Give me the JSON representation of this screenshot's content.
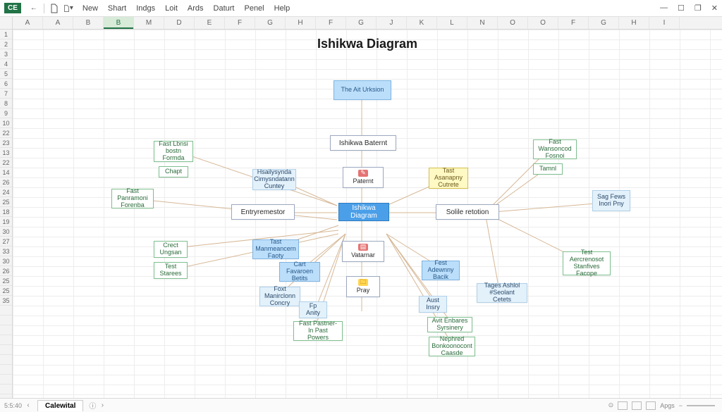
{
  "app_badge": "CE",
  "menu": [
    "New",
    "Shart",
    "Indgs",
    "Loit",
    "Ards",
    "Daturt",
    "Penel",
    "Help"
  ],
  "columns": [
    "A",
    "A",
    "B",
    "B",
    "M",
    "D",
    "E",
    "F",
    "G",
    "H",
    "F",
    "G",
    "J",
    "K",
    "L",
    "N",
    "O",
    "O",
    "F",
    "G",
    "H",
    "I"
  ],
  "selected_col_index": 3,
  "rows": [
    "1",
    "2",
    "3",
    "4",
    "5",
    "6",
    "7",
    "8",
    "9",
    "10",
    "22",
    "23",
    "13",
    "22",
    "14",
    "26",
    "24",
    "25",
    "18",
    "19",
    "30",
    "27",
    "33",
    "30",
    "26",
    "25",
    "25",
    "35",
    "",
    "",
    "",
    "",
    "",
    "",
    "",
    "",
    ""
  ],
  "diagram_title": "Ishikwa Diagram",
  "nodes": {
    "center": "Ishikwa Diagram",
    "top1": "The\nAit Urksion",
    "top2": "Ishikwa Baternt",
    "top3": "Paternt",
    "top4": "Vatarnar",
    "yellow1": "Tast\nAsanapny\nCutrete",
    "left_mid": "Entryremestor",
    "right_mid": "Solile retotion",
    "g1": "Fast\nLbnsi bostn\nFormda",
    "g2": "Chapt",
    "b1": "Hsailysynda\nCimysndatann\nCuntey",
    "g3": "Fast\nPanramoni\nForenba",
    "g4": "Crect\nUngsan",
    "g5": "Test\nStarees",
    "lb1": "Tast\nManmeancern\nFaoty",
    "lb2": "Cart\nFavaroen\nBetits",
    "b2": "Foxt\nManirclonn\nConcry",
    "b3": "Fp\nAnity",
    "g6": "Fast\nPastner-ln Past\nPowers",
    "lb3": "Fest\nAdewnny\nBacik",
    "b4": "Aust\nInsry",
    "g7": "Avit Enbares\nSyrsinery",
    "g8": "Nephred\nBonkoonocont\nCaasde",
    "b5": "Tages\nAshlol #Seolant\nCetets",
    "b6": "Pray",
    "g9": "Fast\nWansoncod\nFosnoi",
    "g10": "Tamnl",
    "b7": "Sag\nFews Inori\nPny",
    "g11": "Test\nAercrenosot\nStanfives\nFacope"
  },
  "sheet_tab": "Calewital",
  "status_left": "5:5:40",
  "status_right": "Apgs"
}
